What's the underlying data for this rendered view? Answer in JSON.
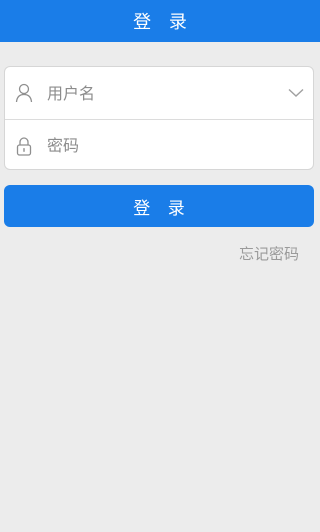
{
  "header": {
    "title": "登 录"
  },
  "form": {
    "username": {
      "placeholder": "用户名",
      "value": ""
    },
    "password": {
      "placeholder": "密码",
      "value": ""
    }
  },
  "actions": {
    "login_label": "登 录",
    "forgot_password_label": "忘记密码"
  },
  "icons": {
    "user": "user-icon",
    "lock": "lock-icon",
    "dropdown": "chevron-down-icon"
  },
  "colors": {
    "accent": "#1a7de8",
    "background": "#ececec",
    "muted_text": "#9a9a9a"
  }
}
